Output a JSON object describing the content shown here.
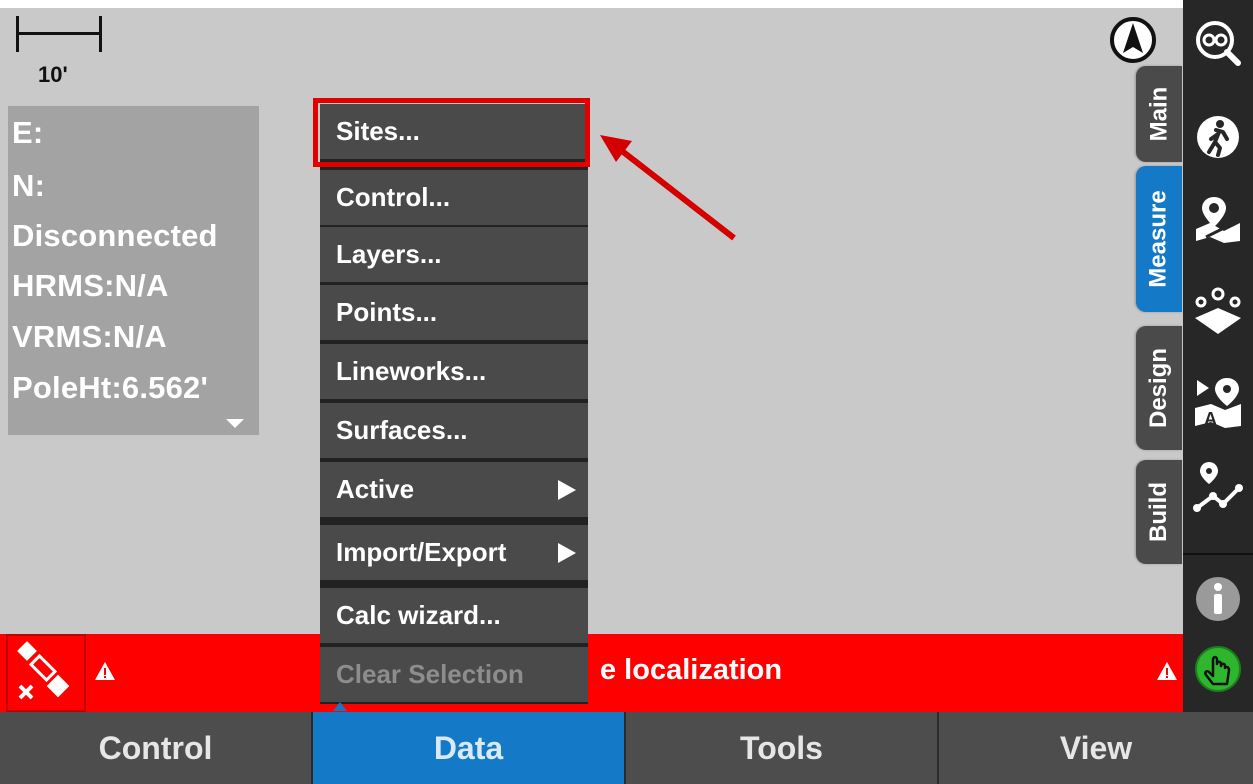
{
  "map": {
    "scale_label": "10'"
  },
  "status_panel": {
    "lines": [
      "E:",
      "N:",
      "Disconnected",
      "HRMS:N/A",
      "VRMS:N/A",
      "PoleHt:6.562'"
    ]
  },
  "side_tabs": [
    {
      "label": "Main",
      "active": false
    },
    {
      "label": "Measure",
      "active": true
    },
    {
      "label": "Design",
      "active": false
    },
    {
      "label": "Build",
      "active": false
    }
  ],
  "toolbar_icons": [
    "zoom-extents-icon",
    "walk-to-icon",
    "map-point-icon",
    "survey-points-icon",
    "stakeout-text-icon",
    "polyline-icon",
    "info-icon",
    "hand-touch-icon"
  ],
  "data_menu": {
    "items": [
      {
        "label": "Sites...",
        "submenu": false,
        "disabled": false
      },
      {
        "label": "Control...",
        "submenu": false,
        "disabled": false
      },
      {
        "label": "Layers...",
        "submenu": false,
        "disabled": false
      },
      {
        "label": "Points...",
        "submenu": false,
        "disabled": false
      },
      {
        "label": "Lineworks...",
        "submenu": false,
        "disabled": false
      },
      {
        "label": "Surfaces...",
        "submenu": false,
        "disabled": false
      },
      {
        "label": "Active",
        "submenu": true,
        "disabled": false
      },
      {
        "label": "Import/Export",
        "submenu": true,
        "disabled": false
      },
      {
        "label": "Calc wizard...",
        "submenu": false,
        "disabled": false
      },
      {
        "label": "Clear Selection",
        "submenu": false,
        "disabled": true
      }
    ]
  },
  "alert": {
    "message": "e localization",
    "color": "#ff0000"
  },
  "bottom_nav": {
    "tabs": [
      {
        "label": "Control",
        "active": false
      },
      {
        "label": "Data",
        "active": true
      },
      {
        "label": "Tools",
        "active": false
      },
      {
        "label": "View",
        "active": false
      }
    ]
  },
  "colors": {
    "accent": "#1479c6",
    "highlight": "#e00000"
  }
}
